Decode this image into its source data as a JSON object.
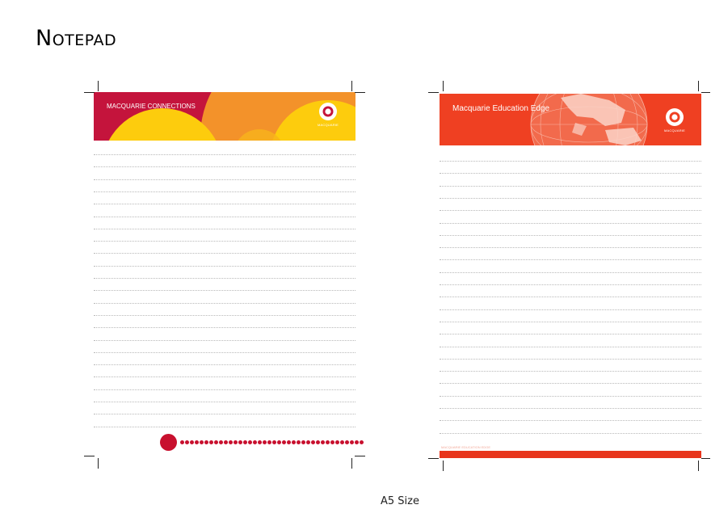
{
  "page": {
    "title": "Notepad",
    "caption": "A5 Size"
  },
  "left_notepad": {
    "banner_title": "MACQUARIE CONNECTIONS",
    "logo_text": "MACQUARIE",
    "colors": {
      "banner_base": "#c4143c",
      "orange": "#f3922a",
      "yellow": "#fdcc0d",
      "dots": "#c8102e"
    }
  },
  "right_notepad": {
    "banner_title": "Macquarie Education Edge",
    "logo_text": "MACQUARIE",
    "footer_small_text": "MACQUARIE EDUCATION EDGE",
    "colors": {
      "banner_base": "#ef4022",
      "footer": "#e8351c"
    }
  }
}
